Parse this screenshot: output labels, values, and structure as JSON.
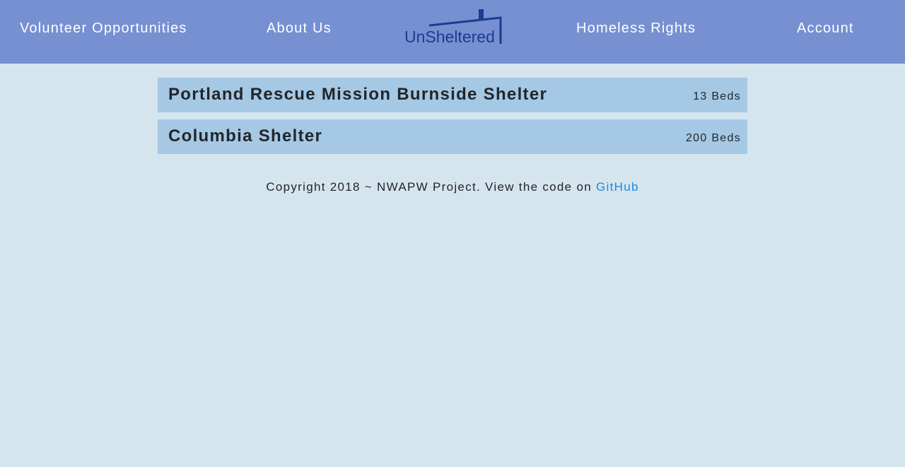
{
  "nav": {
    "volunteer_label": "Volunteer Opportunities",
    "about_label": "About Us",
    "rights_label": "Homeless Rights",
    "account_label": "Account",
    "logo_text": "UnSheltered"
  },
  "shelters": [
    {
      "name": "Portland Rescue Mission Burnside Shelter",
      "beds": "13 Beds"
    },
    {
      "name": "Columbia Shelter",
      "beds": "200 Beds"
    }
  ],
  "footer": {
    "text": "Copyright 2018 ~ NWAPW Project. View the code on",
    "link_label": "GitHub"
  },
  "colors": {
    "navbar": "#7690d2",
    "background": "#d5e5ee",
    "card": "#a5c8e5",
    "logo": "#1b3d8e",
    "link": "#1f86e0"
  }
}
